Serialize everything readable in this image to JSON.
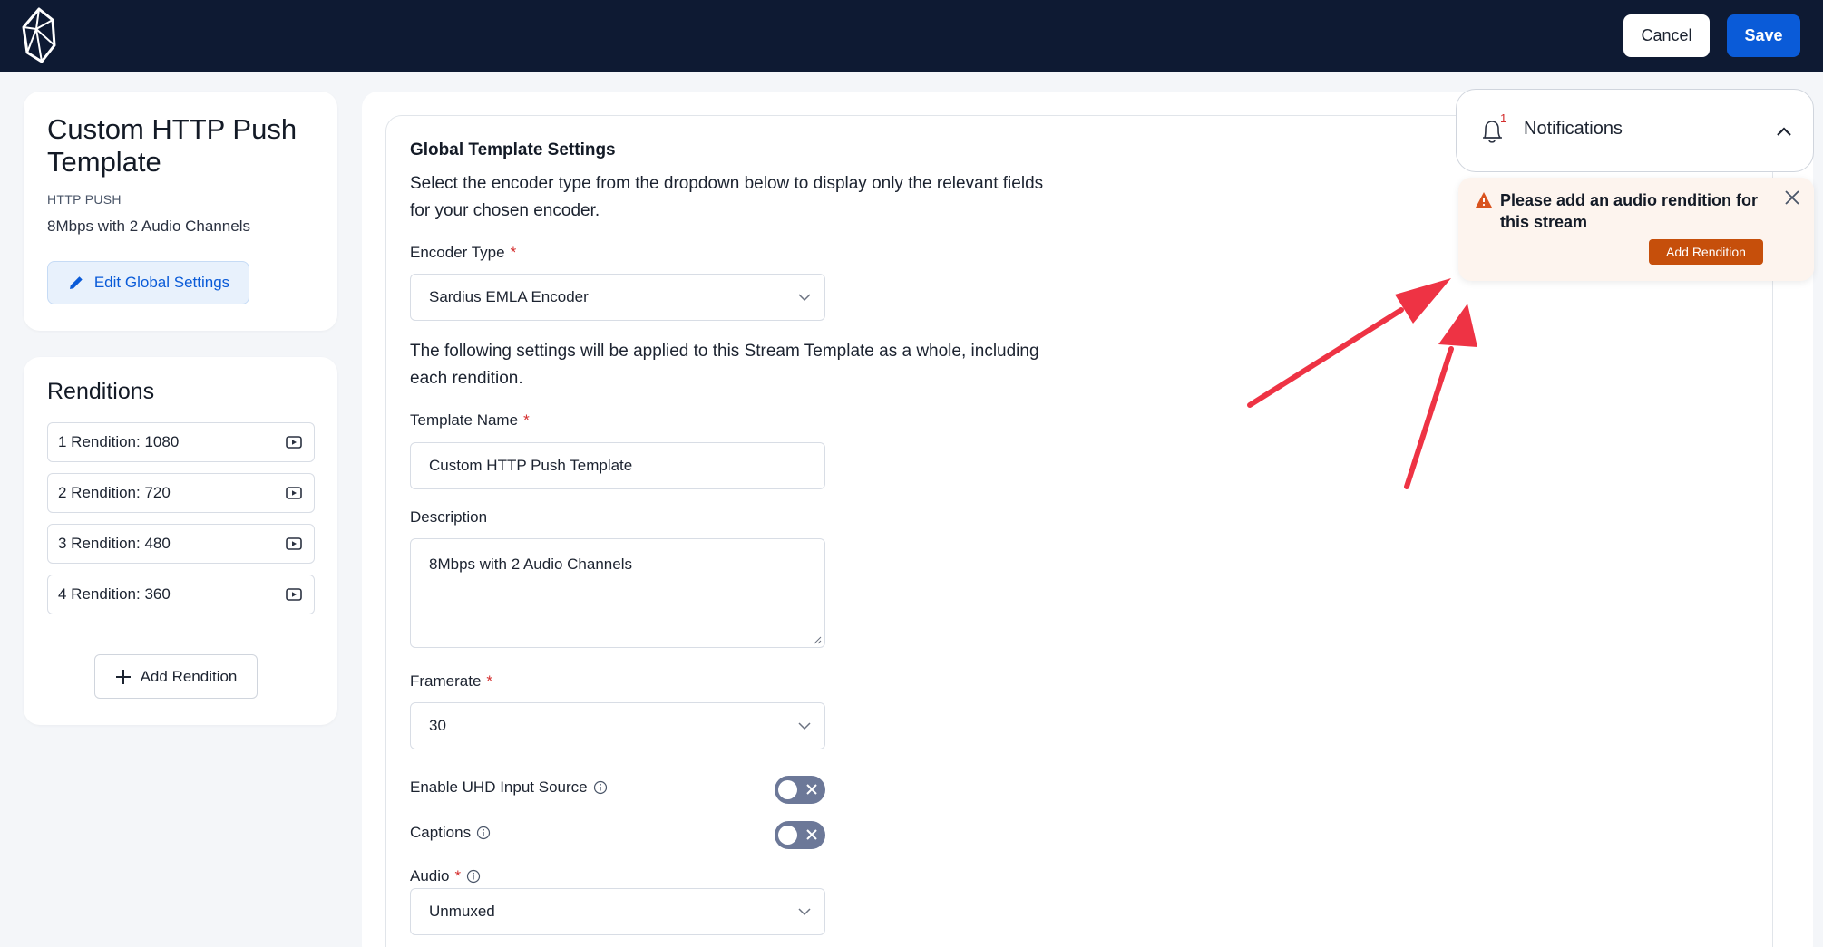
{
  "topbar": {
    "cancel_label": "Cancel",
    "save_label": "Save"
  },
  "template_card": {
    "title": "Custom HTTP Push Template",
    "type": "HTTP PUSH",
    "description": "8Mbps with 2 Audio Channels",
    "edit_label": "Edit Global Settings"
  },
  "renditions": {
    "title": "Renditions",
    "items": [
      {
        "label": "1 Rendition: 1080"
      },
      {
        "label": "2 Rendition: 720"
      },
      {
        "label": "3 Rendition: 480"
      },
      {
        "label": "4 Rendition: 360"
      }
    ],
    "add_label": "Add Rendition"
  },
  "form": {
    "section_title": "Global Template Settings",
    "section_desc": "Select the encoder type from the dropdown below to display only the relevant fields for your chosen encoder.",
    "encoder_label": "Encoder Type",
    "encoder_value": "Sardius EMLA Encoder",
    "applied_desc": "The following settings will be applied to this Stream Template as a whole, including each rendition.",
    "name_label": "Template Name",
    "name_value": "Custom HTTP Push Template",
    "desc_label": "Description",
    "desc_value": "8Mbps with 2 Audio Channels",
    "framerate_label": "Framerate",
    "framerate_value": "30",
    "uhd_label": "Enable UHD Input Source",
    "uhd_on": false,
    "captions_label": "Captions",
    "captions_on": false,
    "audio_label": "Audio",
    "audio_value": "Unmuxed",
    "required_mark": "*"
  },
  "notifications": {
    "title": "Notifications",
    "count": "1",
    "alert_text": "Please add an audio rendition for this stream",
    "alert_button": "Add Rendition"
  },
  "colors": {
    "topbar": "#0e1a33",
    "primary": "#0a5bd8",
    "alert_bg": "#fdf4ee",
    "alert_button": "#c64f0b",
    "annotation_arrow": "#ee3344"
  }
}
